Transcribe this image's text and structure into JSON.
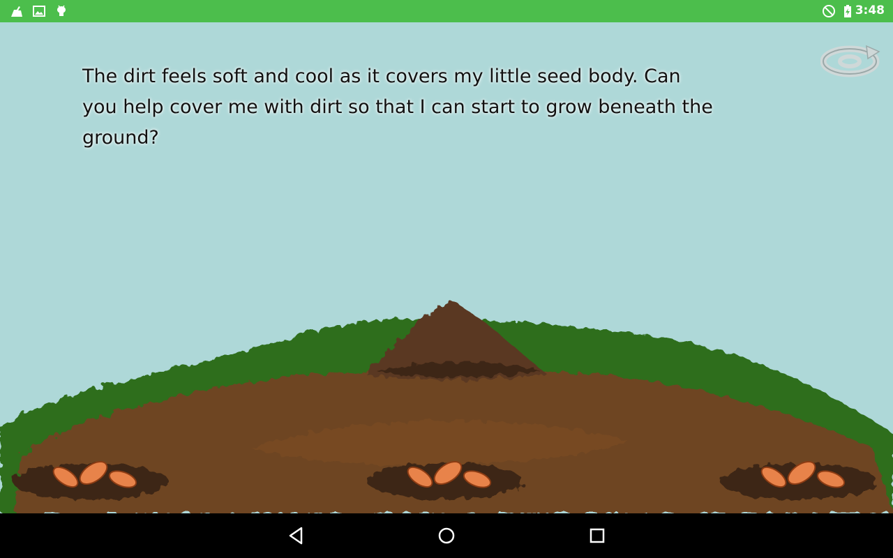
{
  "status_bar": {
    "time": "3:48",
    "background_color": "#4cbe4c",
    "left_icons": [
      "cleaner-app-icon",
      "gallery-icon",
      "android-debug-icon"
    ],
    "right_icons": [
      "do-not-disturb-icon",
      "battery-charging-icon"
    ]
  },
  "game": {
    "story_text": "The dirt feels soft and cool as it covers my little seed body. Can you help cover me with dirt so that I can start to grow beneath the ground?",
    "sky_color": "#aed8d8",
    "soil_color": "#6e4420",
    "grass_color": "#2f6e1e",
    "seed_color": "#e8834a",
    "dirt_pile_color": "#5a3820",
    "seed_holes": 3,
    "seeds_per_hole": 3,
    "replay_icon": "replay-icon"
  },
  "nav_bar": {
    "buttons": [
      "back-icon",
      "home-icon",
      "recents-icon"
    ]
  }
}
